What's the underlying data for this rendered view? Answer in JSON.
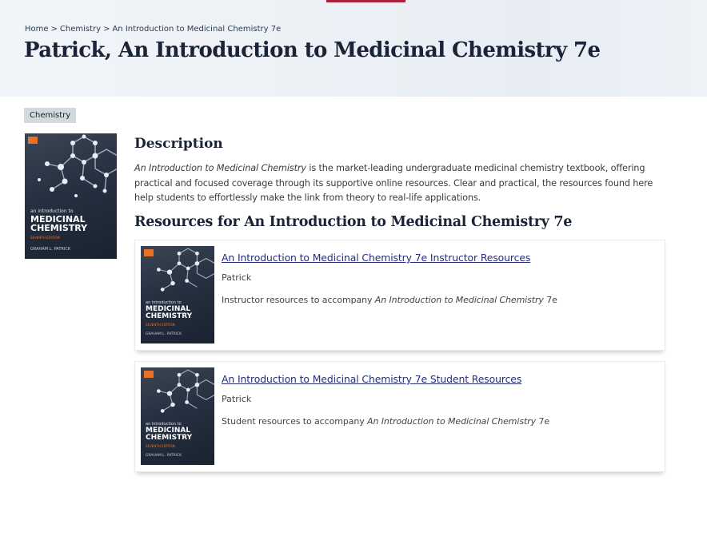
{
  "breadcrumb": {
    "home": "Home",
    "sep": ">",
    "chemistry": "Chemistry",
    "current": "An Introduction to Medicinal Chemistry 7e"
  },
  "page_title": "Patrick, An Introduction to Medicinal Chemistry 7e",
  "tag": "Chemistry",
  "book_cover": {
    "small_line": "an introduction to",
    "title_line1": "MEDICINAL",
    "title_line2": "CHEMISTRY",
    "edition": "SEVENTH EDITION",
    "author": "GRAHAM L. PATRICK"
  },
  "description": {
    "heading": "Description",
    "italic_title": "An Introduction to Medicinal Chemistry",
    "text": " is the market-leading undergraduate medicinal chemistry textbook, offering practical and focused coverage through its supportive online resources. Clear and practical, the resources found here help students to effortlessly make the link from theory to real-life applications."
  },
  "resources": {
    "heading": "Resources for An Introduction to Medicinal Chemistry 7e",
    "items": [
      {
        "title": "An Introduction to Medicinal Chemistry 7e Instructor Resources",
        "author": "Patrick",
        "desc_prefix": "Instructor resources to accompany ",
        "desc_italic": "An Introduction to Medicinal Chemistry",
        "desc_suffix": " 7e"
      },
      {
        "title": "An Introduction to Medicinal Chemistry 7e Student Resources",
        "author": "Patrick",
        "desc_prefix": "Student resources to accompany ",
        "desc_italic": "An Introduction to Medicinal Chemistry",
        "desc_suffix": " 7e"
      }
    ]
  },
  "colors": {
    "accent": "#a8203c",
    "link": "#262c7a",
    "heading": "#1b2436",
    "cover_badge": "#e8712a"
  }
}
